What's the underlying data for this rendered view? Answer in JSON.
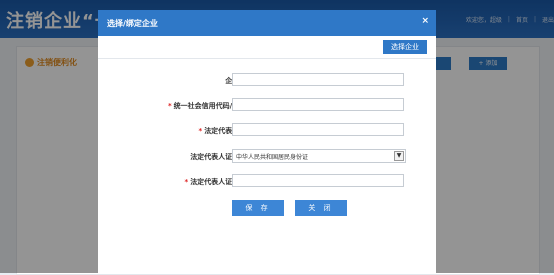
{
  "background": {
    "title": "注销企业“一网",
    "nav": [
      "欢迎您，超级",
      "|",
      "首页",
      "|",
      "退出"
    ],
    "section_label": "注销便利化",
    "right_btn_label": "+ 添加"
  },
  "modal": {
    "title": "选择/绑定企业",
    "close_symbol": "×",
    "choose_label": "选择企业",
    "fields": [
      {
        "label": "企业名称:",
        "required": false,
        "value": ""
      },
      {
        "label": "统一社会信用代码/注册号:",
        "required": true,
        "value": ""
      },
      {
        "label": "法定代表人姓名:",
        "required": true,
        "value": ""
      },
      {
        "label": "法定代表人证件类型:",
        "required": false,
        "selected": "中华人民共和国居民身份证"
      },
      {
        "label": "法定代表人证件号码:",
        "required": true,
        "value": ""
      }
    ],
    "save_label": "保 存",
    "cancel_label": "关 闭",
    "required_mark": "*"
  }
}
